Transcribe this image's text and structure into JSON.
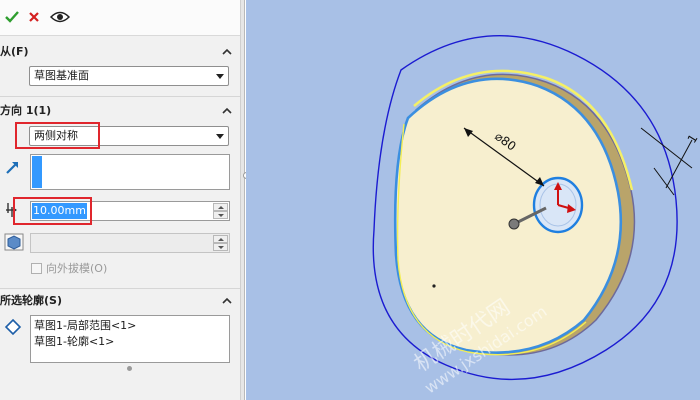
{
  "toolbar": {
    "ok_icon": "check-icon",
    "cancel_icon": "close-icon",
    "preview_icon": "eye-icon"
  },
  "from_section": {
    "title": "从(F)",
    "selected": "草图基准面"
  },
  "direction1_section": {
    "title": "方向 1(1)",
    "end_condition": "两侧对称",
    "depth_value": "10.00mm",
    "draft_outward_label": "向外拔模(O)",
    "draft_outward_checked": false
  },
  "contours_section": {
    "title": "所选轮廓(S)",
    "items": [
      "草图1-局部范围<1>",
      "草图1-轮廓<1>"
    ]
  },
  "viewport": {
    "dimension_label": "⌀80",
    "dimension_side_label": "1",
    "watermark_line1": "机械时代网",
    "watermark_line2": "www.jxshidai.com"
  },
  "colors": {
    "viewport_bg": "#a8c0e6",
    "highlight_red": "#e0262d",
    "selection_blue": "#3399ff",
    "part_face": "#f7efcf"
  }
}
